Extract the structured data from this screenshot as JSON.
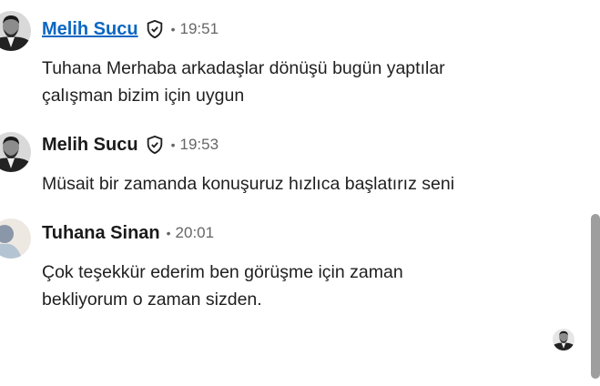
{
  "messages": [
    {
      "sender": "Melih Sucu",
      "verified_icon": "shield-check-icon",
      "separator": "•",
      "time": "19:51",
      "lines": [
        "Tuhana Merhaba arkadaşlar dönüşü bugün yaptılar",
        "çalışman bizim için uygun"
      ]
    },
    {
      "sender": "Melih Sucu",
      "verified_icon": "shield-check-icon",
      "separator": "•",
      "time": "19:53",
      "lines": [
        "Müsait bir zamanda konuşuruz hızlıca başlatırız seni"
      ]
    },
    {
      "sender": "Tuhana Sinan",
      "separator": "•",
      "time": "20:01",
      "lines": [
        "Çok teşekkür ederim ben görüşme için zaman",
        "bekliyorum o zaman sizden."
      ]
    }
  ],
  "colors": {
    "link": "#0a66c2",
    "meta": "#666666",
    "text": "#1f1f1f",
    "scrollbar_thumb": "#9e9e9e"
  },
  "read_receipt_icon": "avatar-icon"
}
